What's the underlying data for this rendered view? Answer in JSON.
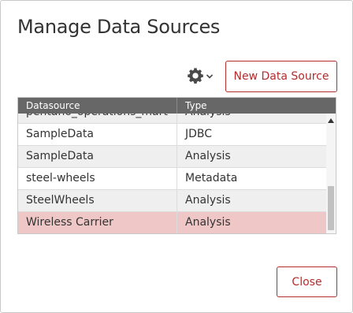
{
  "dialog": {
    "title": "Manage Data Sources",
    "new_button_label": "New Data Source",
    "close_button_label": "Close",
    "gear_icon": "gear-icon",
    "accent_color": "#b22d2d"
  },
  "table": {
    "columns": [
      "Datasource",
      "Type"
    ],
    "rows": [
      {
        "datasource": "pentaho_operations_mart",
        "type": "Analysis"
      },
      {
        "datasource": "SampleData",
        "type": "JDBC"
      },
      {
        "datasource": "SampleData",
        "type": "Analysis"
      },
      {
        "datasource": "steel-wheels",
        "type": "Metadata"
      },
      {
        "datasource": "SteelWheels",
        "type": "Analysis"
      },
      {
        "datasource": "Wireless Carrier",
        "type": "Analysis"
      }
    ],
    "selected_row": "Wireless Carrier"
  }
}
